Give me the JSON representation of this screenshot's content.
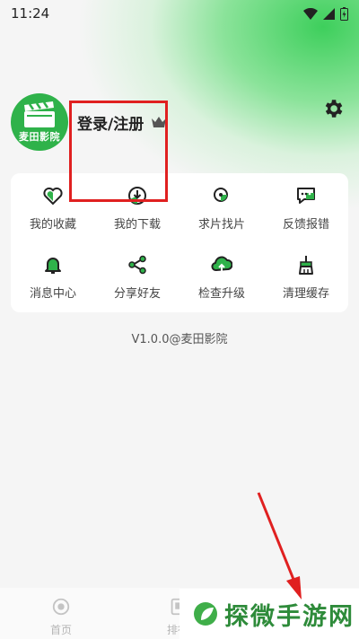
{
  "status_bar": {
    "time": "11:24"
  },
  "profile": {
    "avatar_label": "麦田影院",
    "login_text": "登录/注册"
  },
  "menu": {
    "items": [
      {
        "label": "我的收藏",
        "icon": "heart-icon"
      },
      {
        "label": "我的下载",
        "icon": "download-icon"
      },
      {
        "label": "求片找片",
        "icon": "search-film-icon"
      },
      {
        "label": "反馈报错",
        "icon": "feedback-icon"
      },
      {
        "label": "消息中心",
        "icon": "bell-icon"
      },
      {
        "label": "分享好友",
        "icon": "share-icon"
      },
      {
        "label": "检查升级",
        "icon": "upgrade-icon"
      },
      {
        "label": "清理缓存",
        "icon": "broom-icon"
      }
    ]
  },
  "version": "V1.0.0@麦田影院",
  "bottom_nav": {
    "home_label": "首页",
    "rank_label": "排行"
  },
  "watermark": {
    "text": "探微手游网"
  },
  "colors": {
    "accent": "#2fb24a",
    "annotation": "#e02020"
  }
}
